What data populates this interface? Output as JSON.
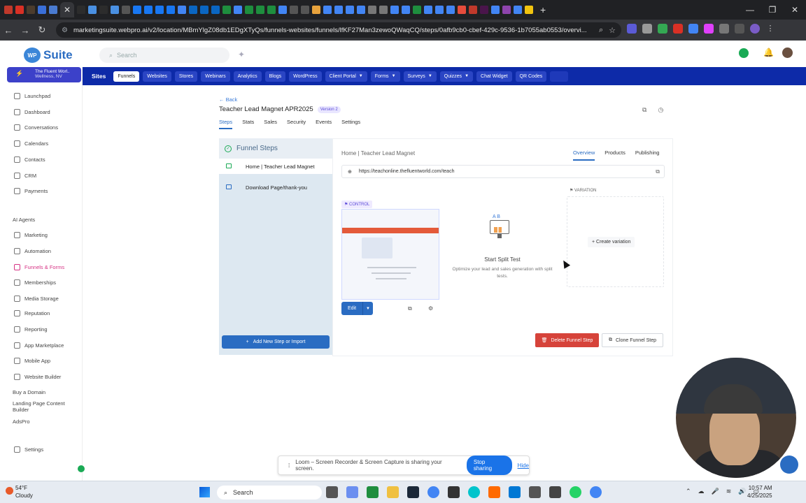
{
  "browser": {
    "url": "marketingsuite.webpro.ai/v2/location/MBmYlgZ08db1EDgXTyQs/funnels-websites/funnels/lfKF27Man3zewoQWaqCQ/steps/0afb9cb0-cbef-429c-9536-1b7055ab0553/overvi...",
    "tab_close": "✕",
    "new_tab": "+"
  },
  "app": {
    "logo_ball": "WP",
    "logo_text": "Suite",
    "search_placeholder": "Search"
  },
  "account": {
    "name": "The Fluent Worl..",
    "location": "Wellness, NV"
  },
  "sidebar": {
    "items": [
      {
        "label": "Launchpad"
      },
      {
        "label": "Dashboard"
      },
      {
        "label": "Conversations"
      },
      {
        "label": "Calendars"
      },
      {
        "label": "Contacts"
      },
      {
        "label": "CRM"
      },
      {
        "label": "Payments"
      },
      {
        "label": "AI Agents"
      },
      {
        "label": "Marketing"
      },
      {
        "label": "Automation"
      },
      {
        "label": "Funnels & Forms"
      },
      {
        "label": "Memberships"
      },
      {
        "label": "Media Storage"
      },
      {
        "label": "Reputation"
      },
      {
        "label": "Reporting"
      },
      {
        "label": "App Marketplace"
      },
      {
        "label": "Mobile App"
      },
      {
        "label": "Website Builder"
      },
      {
        "label": "Buy a Domain"
      },
      {
        "label": "Landing Page Content Builder"
      },
      {
        "label": "AdsPro"
      },
      {
        "label": "Settings"
      }
    ]
  },
  "topnav": {
    "title": "Sites",
    "items": [
      "Funnels",
      "Websites",
      "Stores",
      "Webinars",
      "Analytics",
      "Blogs",
      "WordPress",
      "Client Portal",
      "Forms",
      "Surveys",
      "Quizzes",
      "Chat Widget",
      "QR Codes"
    ]
  },
  "page": {
    "back": "Back",
    "title": "Teacher Lead Magnet APR2025",
    "version": "Version 2",
    "tabs": [
      "Steps",
      "Stats",
      "Sales",
      "Security",
      "Events",
      "Settings"
    ]
  },
  "steps_panel": {
    "header": "Funnel Steps",
    "steps": [
      "Home | Teacher Lead Magnet",
      "Download Page/thank-you"
    ],
    "add_button": "Add New Step or Import"
  },
  "detail": {
    "breadcrumb": "Home | Teacher Lead Magnet",
    "tabs": [
      "Overview",
      "Products",
      "Publishing"
    ],
    "url": "https://teachonline.thefluentworld.com/teach",
    "control_label": "CONTROL",
    "variation_label": "VARIATION",
    "edit_label": "Edit",
    "split_title": "Start Split Test",
    "split_sub": "Optimize your lead and sales generation with split tests.",
    "create_variation": "Create variation",
    "delete_step": "Delete Funnel Step",
    "clone_step": "Clone Funnel Step"
  },
  "loom": {
    "message": "Loom – Screen Recorder & Screen Capture is sharing your screen.",
    "stop": "Stop sharing",
    "hide": "Hide"
  },
  "taskbar": {
    "temp": "54°F",
    "weather": "Cloudy",
    "search": "Search",
    "time": "10:57 AM",
    "date": "4/25/2025"
  }
}
